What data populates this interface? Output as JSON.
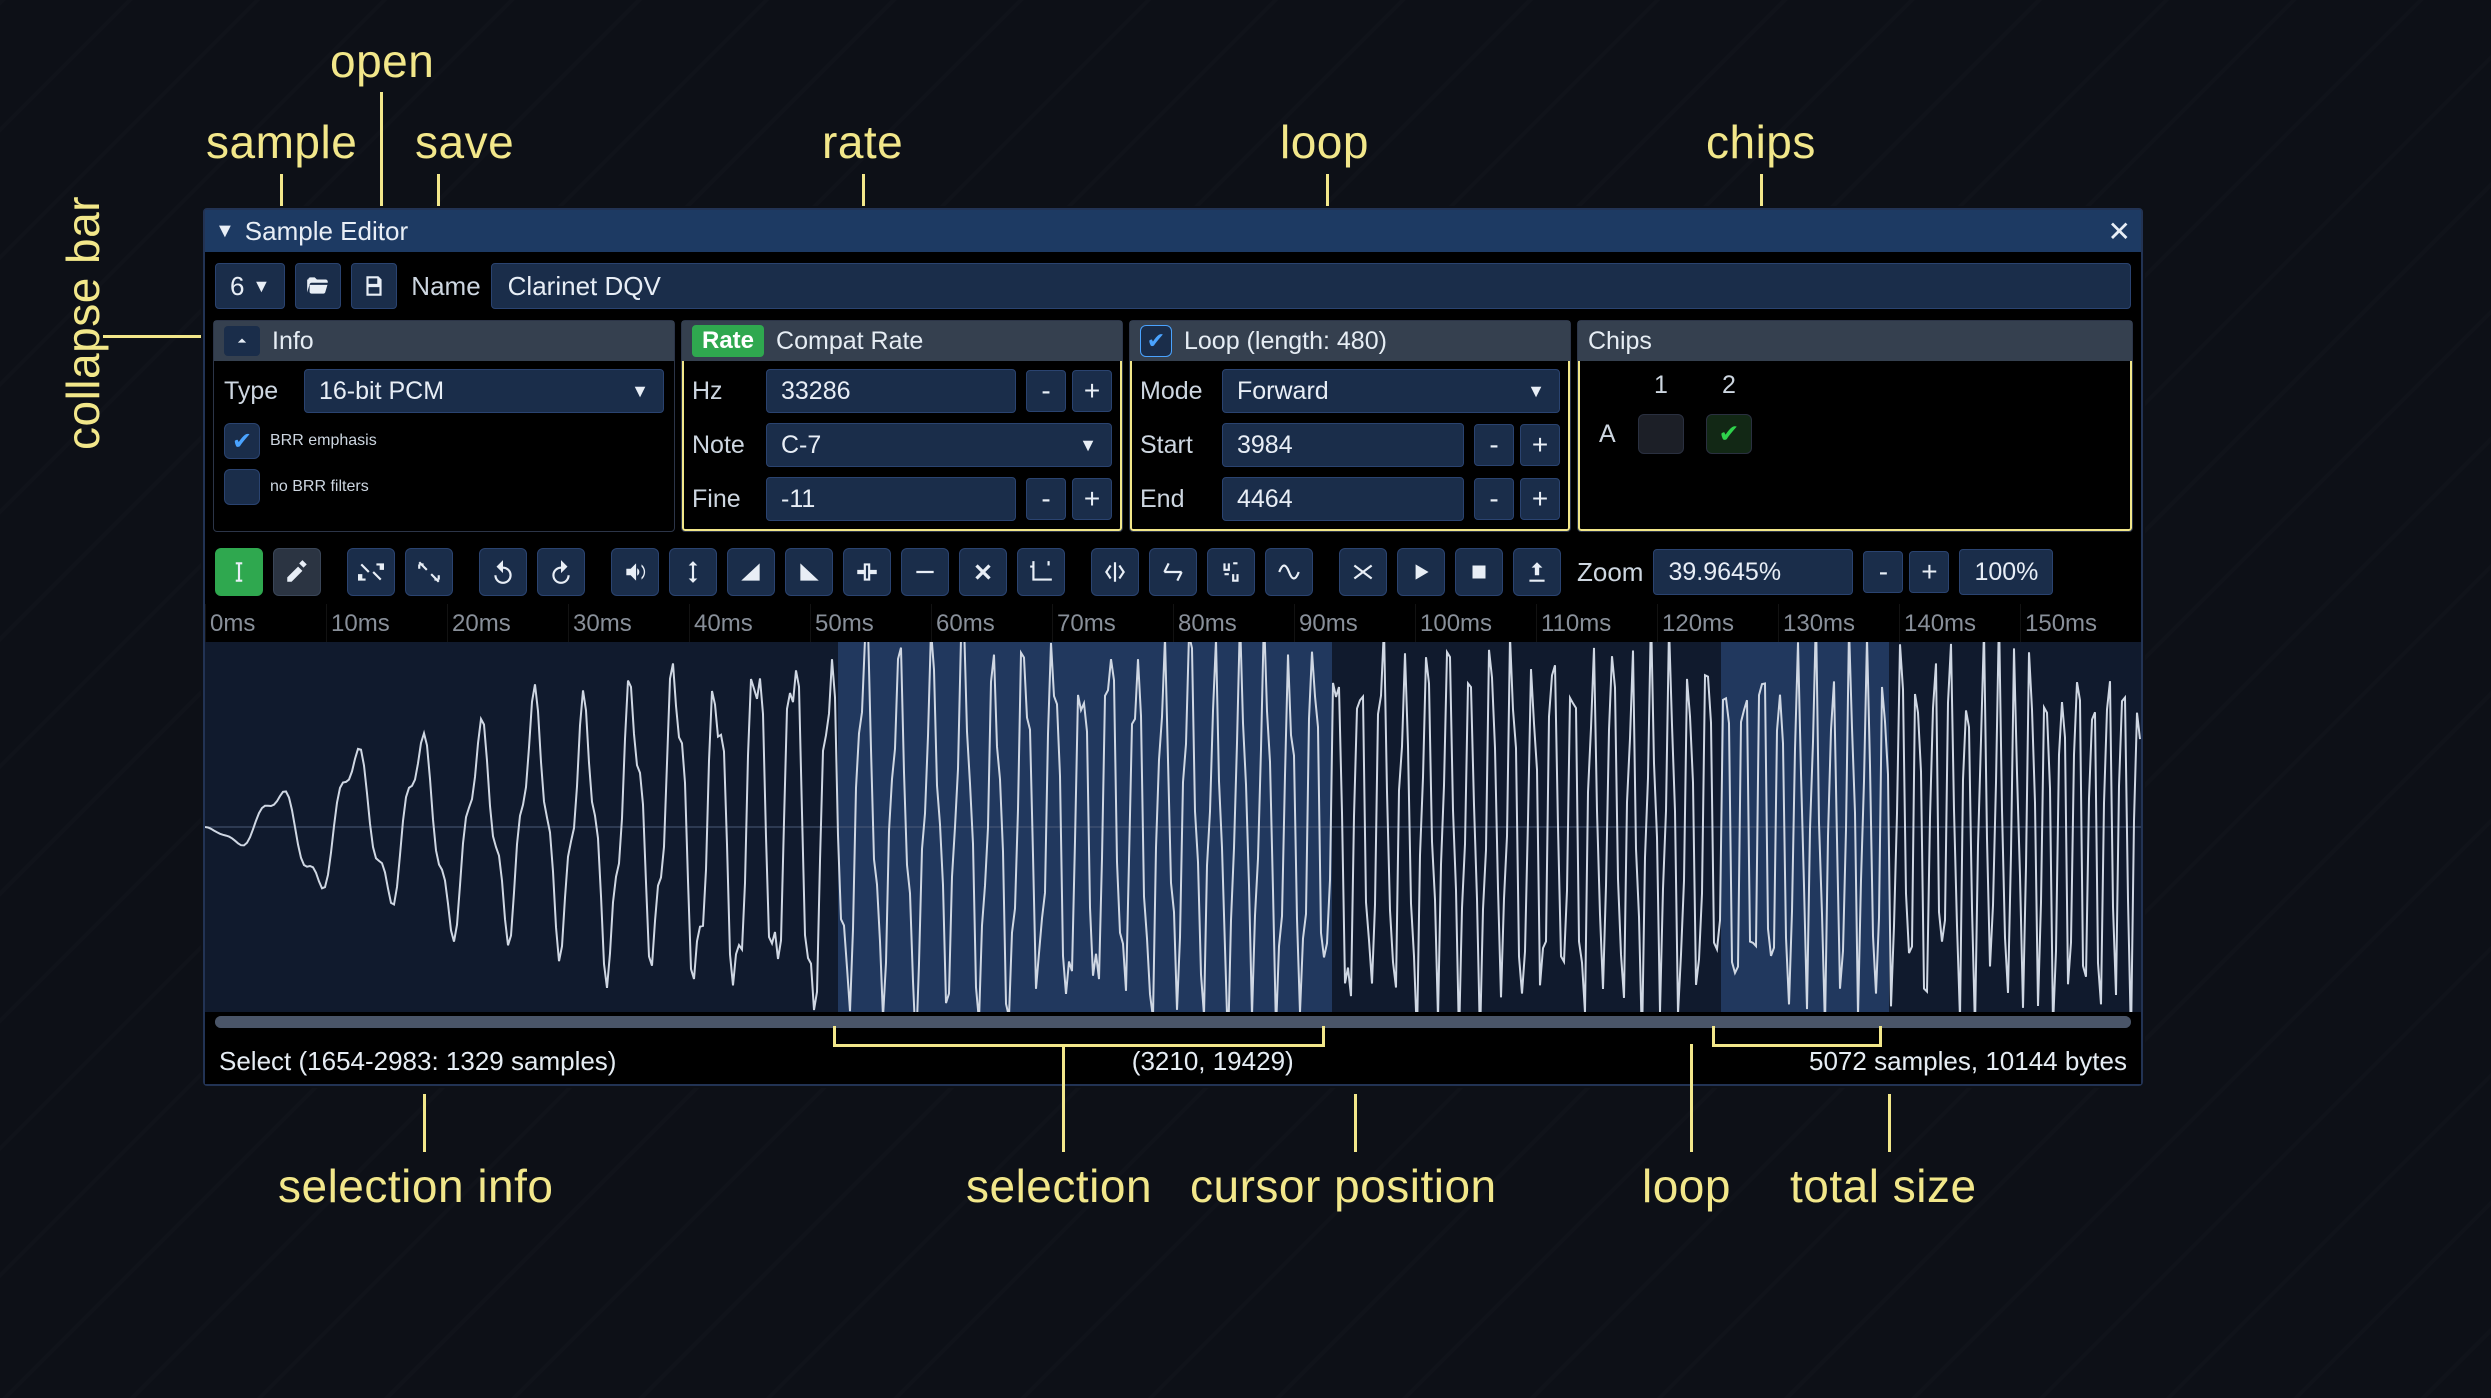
{
  "callouts": {
    "sample": "sample",
    "open": "open",
    "save": "save",
    "rate": "rate",
    "loop": "loop",
    "chips": "chips",
    "collapse_bar": "collapse bar",
    "selection_info": "selection info",
    "selection": "selection",
    "cursor_position": "cursor position",
    "loop_bottom": "loop",
    "total_size": "total size"
  },
  "window_title": "Sample Editor",
  "sample_index": "6",
  "name_label": "Name",
  "sample_name": "Clarinet DQV",
  "info": {
    "header": "Info",
    "type_label": "Type",
    "type_value": "16-bit PCM",
    "brr_emphasis_label": "BRR emphasis",
    "brr_emphasis_checked": true,
    "no_brr_filters_label": "no BRR filters",
    "no_brr_filters_checked": false
  },
  "rate": {
    "badge": "Rate",
    "header": "Compat Rate",
    "hz_label": "Hz",
    "hz_value": "33286",
    "note_label": "Note",
    "note_value": "C-7",
    "fine_label": "Fine",
    "fine_value": "-11"
  },
  "loop": {
    "header": "Loop (length: 480)",
    "checked": true,
    "mode_label": "Mode",
    "mode_value": "Forward",
    "start_label": "Start",
    "start_value": "3984",
    "end_label": "End",
    "end_value": "4464"
  },
  "chips": {
    "header": "Chips",
    "cols": [
      "1",
      "2"
    ],
    "rows": [
      "A"
    ],
    "state": [
      [
        false,
        true
      ]
    ]
  },
  "zoom": {
    "label": "Zoom",
    "value": "39.9645%",
    "full": "100%"
  },
  "ruler_ticks": [
    "0ms",
    "10ms",
    "20ms",
    "30ms",
    "40ms",
    "50ms",
    "60ms",
    "70ms",
    "80ms",
    "90ms",
    "100ms",
    "110ms",
    "120ms",
    "130ms",
    "140ms",
    "150ms"
  ],
  "status": {
    "selection": "Select (1654-2983: 1329 samples)",
    "cursor": "(3210, 19429)",
    "size": "5072 samples, 10144 bytes"
  },
  "minus": "-",
  "plus": "+"
}
